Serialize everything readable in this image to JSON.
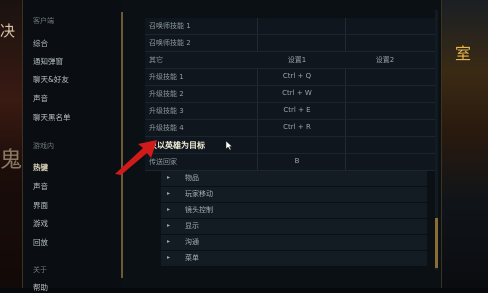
{
  "background": {
    "left_text": "决",
    "left_text2": "鬼",
    "right_text": "室"
  },
  "sidebar": {
    "section1": "客户端",
    "items1": [
      "综合",
      "通知弹窗",
      "聊天&好友",
      "声音",
      "聊天黑名单"
    ],
    "section2": "游戏内",
    "items2": [
      "热键",
      "声音",
      "界面",
      "游戏",
      "回放"
    ],
    "section3": "关于",
    "items3": [
      "帮助"
    ]
  },
  "keybinds": {
    "top_rows": [
      "召唤师技能 1",
      "召唤师技能 2"
    ],
    "headers": {
      "name": "其它",
      "primary": "设置1",
      "secondary": "设置2"
    },
    "rows": [
      {
        "name": "升级技能 1",
        "primary": "Ctrl + Q",
        "secondary": ""
      },
      {
        "name": "升级技能 2",
        "primary": "Ctrl + W",
        "secondary": ""
      },
      {
        "name": "升级技能 3",
        "primary": "Ctrl + E",
        "secondary": ""
      },
      {
        "name": "升级技能 4",
        "primary": "Ctrl + R",
        "secondary": ""
      },
      {
        "name": "只以英雄为目标",
        "primary": "",
        "secondary": ""
      },
      {
        "name": "传送回家",
        "primary": "B",
        "secondary": ""
      }
    ]
  },
  "sections": [
    "物品",
    "玩家移动",
    "镜头控制",
    "显示",
    "沟通",
    "菜单"
  ],
  "colors": {
    "accent": "#8a6d32",
    "annotation_arrow": "#d11a1a"
  }
}
